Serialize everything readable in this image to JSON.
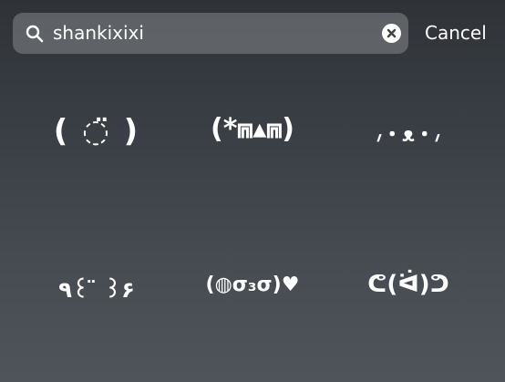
{
  "search": {
    "value": "shankixixi",
    "icon": "search-icon",
    "clear_icon": "clear-icon"
  },
  "cancel_label": "Cancel",
  "results": [
    "( ◌̈ )",
    "(*⩎▴⩎)",
    "៸・ᴥ・៸",
    "٩꒰ ̈ ꒱۶",
    "(◍σ₃σ)♥",
    "ᕦ(ᐛ)ᕤ"
  ]
}
